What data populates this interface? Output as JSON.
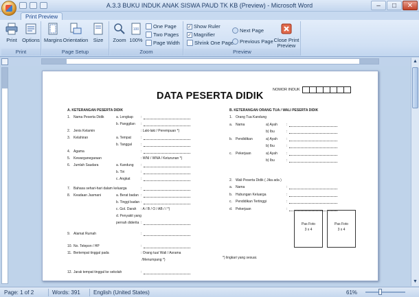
{
  "window": {
    "title": "A.3.3 BUKU INDUK ANAK SISWA PAUD TK KB (Preview) - Microsoft Word"
  },
  "tab": {
    "label": "Print Preview"
  },
  "ribbon": {
    "print_group": {
      "label": "Print",
      "print": "Print",
      "options": "Options"
    },
    "page_setup_group": {
      "label": "Page Setup",
      "margins": "Margins",
      "orientation": "Orientation",
      "size": "Size"
    },
    "zoom_group": {
      "label": "Zoom",
      "zoom": "Zoom",
      "hundred": "100%",
      "one_page": "One Page",
      "two_pages": "Two Pages",
      "page_width": "Page Width"
    },
    "preview_group": {
      "label": "Preview",
      "show_ruler": "Show Ruler",
      "magnifier": "Magnifier",
      "shrink_one_page": "Shrink One Page",
      "next_page": "Next Page",
      "previous_page": "Previous Page",
      "close": "Close Print Preview"
    }
  },
  "document": {
    "title": "DATA PESERTA DIDIK",
    "nomor_induk": "NOMOR INDUK",
    "section_a": "A.   KETERANGAN  PESERTA  DIDIK",
    "section_b": "B.   KETERANGAN ORANG TUA / WALI PESERTA  DIDIK",
    "a_rows": [
      {
        "num": "1.",
        "label": "Nama Peserta Didik",
        "sub": "a. Lengkap",
        "value": ":"
      },
      {
        "num": "",
        "label": "",
        "sub": "b. Panggilan",
        "value": ":"
      },
      {
        "num": "2.",
        "label": "Jenis Kelamin",
        "sub": "",
        "value": ": Laki-laki  / Perempuan *)"
      },
      {
        "num": "3.",
        "label": "Kelahiran",
        "sub": "a. Tempat",
        "value": ":"
      },
      {
        "num": "",
        "label": "",
        "sub": "b. Tanggal",
        "value": ":"
      },
      {
        "num": "4.",
        "label": "Agama",
        "sub": "",
        "value": ":"
      },
      {
        "num": "5.",
        "label": "Kewarganegaraan",
        "sub": "",
        "value": ": WNI / WNA / Keturunan *)"
      },
      {
        "num": "6.",
        "label": "Jumlah Saudara",
        "sub": "a. Kandung",
        "value": ":"
      },
      {
        "num": "",
        "label": "",
        "sub": "b. Tiri",
        "value": ":"
      },
      {
        "num": "",
        "label": "",
        "sub": "c. Angkat",
        "value": ":"
      },
      {
        "num": "7.",
        "label": "Bahasa sehari-hari dalam keluarga",
        "sub": "",
        "value": ":"
      },
      {
        "num": "8.",
        "label": "Keadaan Jasmani",
        "sub": "a. Berat badan",
        "value": ":"
      },
      {
        "num": "",
        "label": "",
        "sub": "b. Tinggi badan",
        "value": ":"
      },
      {
        "num": "",
        "label": "",
        "sub": "c. Gol. Darah",
        "value": ":  A  /  B  /  O  /  AB  /     / *)"
      },
      {
        "num": "",
        "label": "",
        "sub": "d. Penyakit yang",
        "value": ""
      },
      {
        "num": "",
        "label": "",
        "sub": "   pernah diderita",
        "value": ":"
      },
      {
        "num": "9.",
        "label": "Alamat Rumah",
        "sub": "",
        "value": ":"
      },
      {
        "num": "10.",
        "label": "No. Telepon / HP",
        "sub": "",
        "value": ":"
      },
      {
        "num": "11.",
        "label": "Bertempat tinggal pada",
        "sub": "",
        "value": ": Orang tua/ Wali / Asrama"
      },
      {
        "num": "",
        "label": "",
        "sub": "",
        "value": "  /Menumpang *)"
      },
      {
        "num": "12.",
        "label": "Jarak tempat tinggal ke sekolah",
        "sub": "",
        "value": ":"
      }
    ],
    "b_rows": [
      {
        "num": "1.",
        "label": "Orang Tua Kandung",
        "sub": "",
        "value": ""
      },
      {
        "num": "a.",
        "label": "Nama",
        "sub": "a) Ayah",
        "value": ":"
      },
      {
        "num": "",
        "label": "",
        "sub": "b) Ibu",
        "value": ":"
      },
      {
        "num": "b.",
        "label": "Pendidikan",
        "sub": "a) Ayah",
        "value": ":"
      },
      {
        "num": "",
        "label": "",
        "sub": "b) Ibu",
        "value": ":"
      },
      {
        "num": "c.",
        "label": "Pekerjaan",
        "sub": "a) Ayah",
        "value": ":"
      },
      {
        "num": "",
        "label": "",
        "sub": "b) Ibu",
        "value": ":"
      },
      {
        "num": "2.",
        "label": "Wali Peserta Didik ( Jika ada )",
        "sub": "",
        "value": ""
      },
      {
        "num": "a.",
        "label": "Nama",
        "sub": "",
        "value": ":"
      },
      {
        "num": "b.",
        "label": "Hubungan Keluarga",
        "sub": "",
        "value": ":"
      },
      {
        "num": "c.",
        "label": "Pendidikan Tertinggi",
        "sub": "",
        "value": ":"
      },
      {
        "num": "d.",
        "label": "Pekerjaan",
        "sub": "",
        "value": ":"
      }
    ],
    "photo_label": "Pas Foto",
    "photo_size": "3 x 4",
    "footnote": "*) lingkari yang sesuai."
  },
  "status": {
    "page": "Page: 1 of 2",
    "words": "Words: 391",
    "language": "English (United States)",
    "zoom": "61%"
  }
}
